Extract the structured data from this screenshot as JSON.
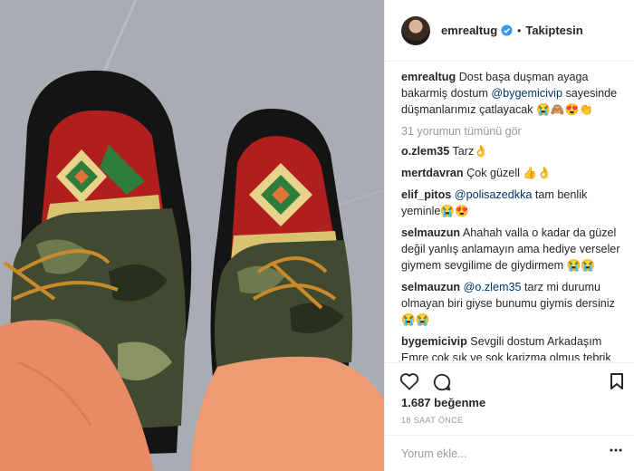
{
  "post": {
    "username": "emrealtug",
    "follow_state": "Takiptesin",
    "caption": {
      "author": "emrealtug",
      "text_before": "Dost başa duşman ayaga bakarmiş dostum ",
      "mention": "@bygemicivip",
      "text_after": " sayesinde düşmanlarımız çatlayacak",
      "emojis": "😭🙈😍👏"
    },
    "view_all_comments": "31 yorumun tümünü gör",
    "comments": [
      {
        "author": "o.zlem35",
        "text": "Tarz👌"
      },
      {
        "author": "mertdavran",
        "text": "Çok güzell 👍👌"
      },
      {
        "author": "elif_pitos",
        "mention": "@polisazedkka",
        "text": " tam benlik yeminle😭😍"
      },
      {
        "author": "selmauzun",
        "text": "Ahahah valla o kadar da güzel değil yanlış anlamayın ama hediye verseler giymem sevgilime de giydirmem 😭😭"
      },
      {
        "author": "selmauzun",
        "mention": "@o.zlem35",
        "text": " tarz mi durumu olmayan biri giyse bunumu giymis dersiniz 😭😭"
      },
      {
        "author": "bygemicivip",
        "text": "Sevgili dostum Arkadaşım Emre çok şık ve şok karizma olmuş tebrik ederim seni ve devamı geliyor senin Uğur'un çok iyi geliyor bana allah çok"
      }
    ],
    "likes": "1.687 beğenme",
    "time": "18 SAAT ÖNCE",
    "comment_placeholder": "Yorum ekle...",
    "colors": {
      "link": "#003569",
      "verified": "#3897f0",
      "muted": "#999999"
    },
    "icons": [
      "heart-icon",
      "comment-icon",
      "bookmark-icon",
      "more-options-icon",
      "verified-badge-icon"
    ]
  }
}
